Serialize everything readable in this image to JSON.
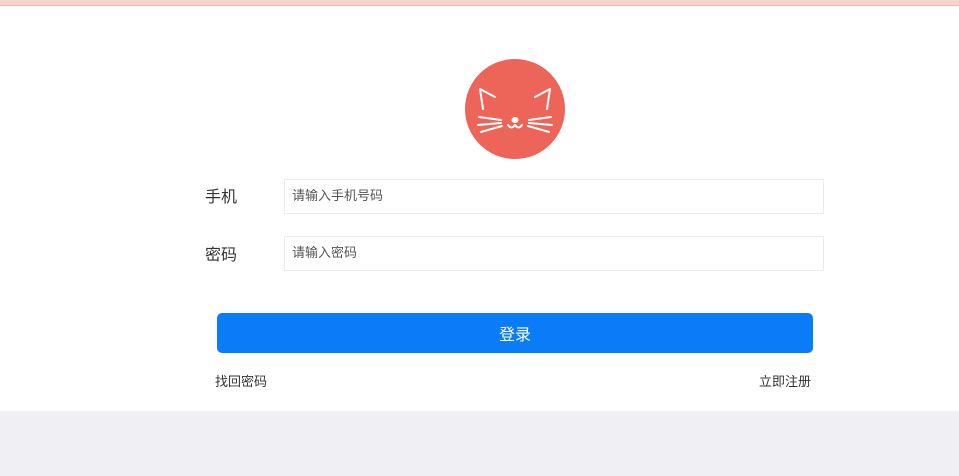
{
  "logo": {
    "icon": "cat-face-icon",
    "background": "#ec6558"
  },
  "form": {
    "phone_label": "手机",
    "phone_placeholder": "请输入手机号码",
    "password_label": "密码",
    "password_placeholder": "请输入密码",
    "login_label": "登录"
  },
  "links": {
    "forgot_password": "找回密码",
    "register": "立即注册"
  },
  "colors": {
    "accent": "#0a7cf8",
    "page_background": "#efeff4"
  }
}
